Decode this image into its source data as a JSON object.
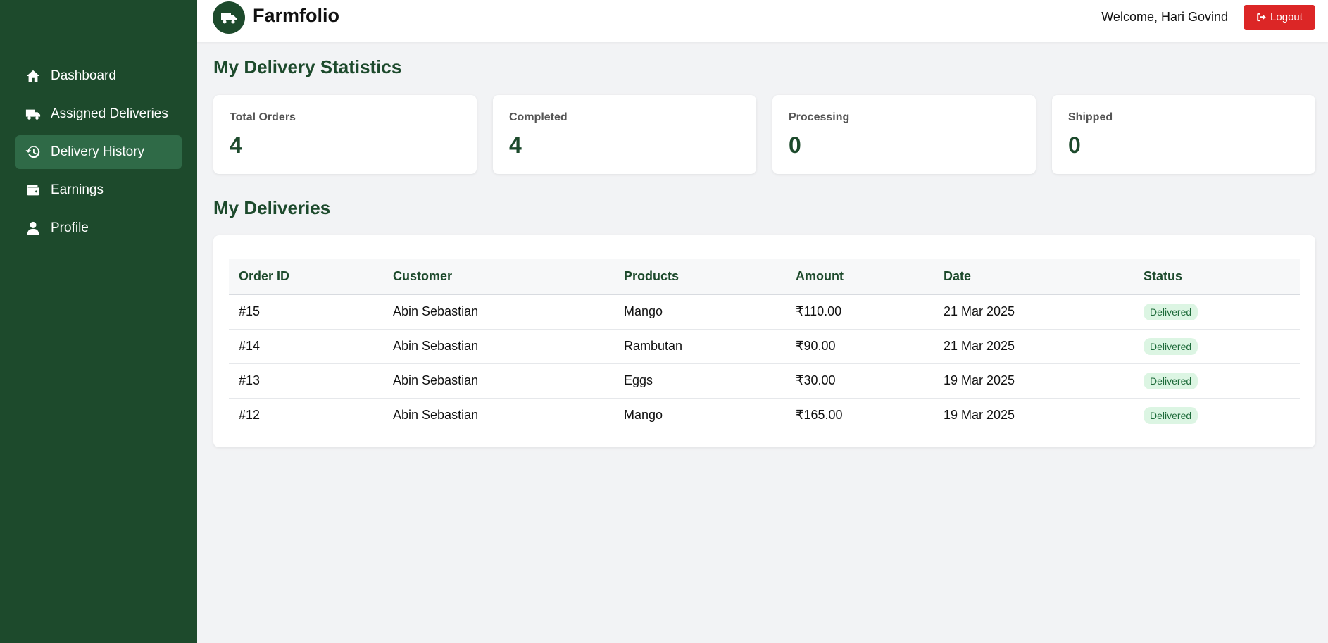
{
  "app": {
    "title": "Farmfolio",
    "logo_icon": "truck-icon"
  },
  "header": {
    "welcome": "Welcome, Hari Govind",
    "logout_label": "Logout",
    "logout_icon": "sign-out-icon",
    "logout_color": "#dc2626"
  },
  "sidebar": {
    "items": [
      {
        "label": "Dashboard",
        "icon": "home-icon",
        "active": false
      },
      {
        "label": "Assigned Deliveries",
        "icon": "truck-icon",
        "active": false
      },
      {
        "label": "Delivery History",
        "icon": "history-icon",
        "active": true
      },
      {
        "label": "Earnings",
        "icon": "wallet-icon",
        "active": false
      },
      {
        "label": "Profile",
        "icon": "user-icon",
        "active": false
      }
    ]
  },
  "stats": {
    "title": "My Delivery Statistics",
    "cards": [
      {
        "label": "Total Orders",
        "value": "4"
      },
      {
        "label": "Completed",
        "value": "4"
      },
      {
        "label": "Processing",
        "value": "0"
      },
      {
        "label": "Shipped",
        "value": "0"
      }
    ]
  },
  "deliveries": {
    "title": "My Deliveries",
    "columns": [
      "Order ID",
      "Customer",
      "Products",
      "Amount",
      "Date",
      "Status"
    ],
    "rows": [
      {
        "order_id": "#15",
        "customer": "Abin Sebastian",
        "products": "Mango",
        "amount": "₹110.00",
        "date": "21 Mar 2025",
        "status": "Delivered"
      },
      {
        "order_id": "#14",
        "customer": "Abin Sebastian",
        "products": "Rambutan",
        "amount": "₹90.00",
        "date": "21 Mar 2025",
        "status": "Delivered"
      },
      {
        "order_id": "#13",
        "customer": "Abin Sebastian",
        "products": "Eggs",
        "amount": "₹30.00",
        "date": "19 Mar 2025",
        "status": "Delivered"
      },
      {
        "order_id": "#12",
        "customer": "Abin Sebastian",
        "products": "Mango",
        "amount": "₹165.00",
        "date": "19 Mar 2025",
        "status": "Delivered"
      }
    ]
  },
  "colors": {
    "sidebar": "#1d4a2c",
    "accent": "#1d4a2c",
    "active_item": "#2f6a47",
    "badge_bg": "#dcf5e3",
    "badge_text": "#1e6b3a"
  }
}
